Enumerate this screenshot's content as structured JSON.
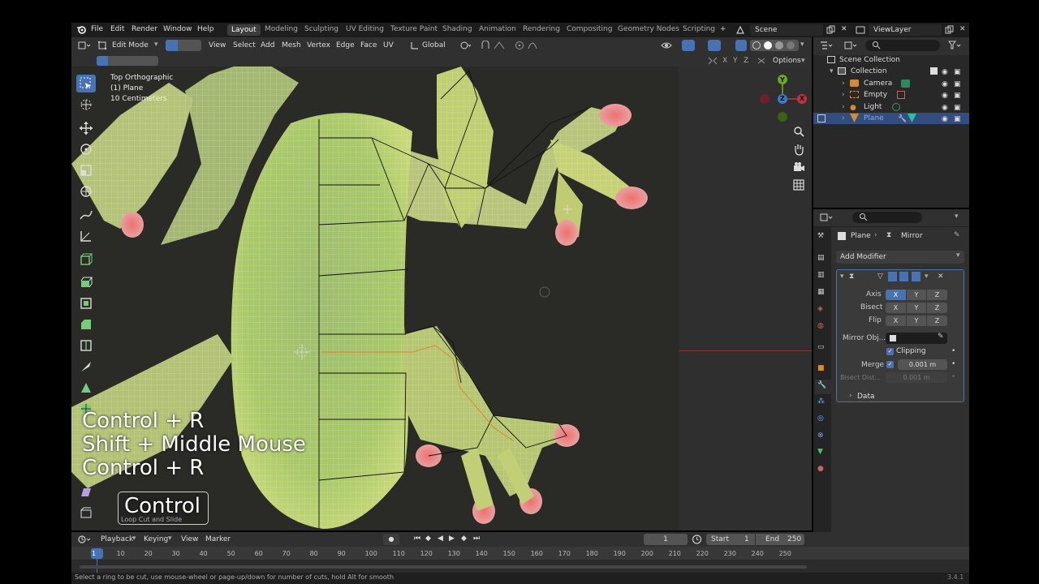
{
  "menus": [
    "File",
    "Edit",
    "Render",
    "Window",
    "Help"
  ],
  "workspaces": [
    "Layout",
    "Modeling",
    "Sculpting",
    "UV Editing",
    "Texture Paint",
    "Shading",
    "Animation",
    "Rendering",
    "Compositing",
    "Geometry Nodes",
    "Scripting"
  ],
  "scene": "Scene",
  "view_layer": "ViewLayer",
  "viewport_header": {
    "mode": "Edit Mode",
    "menus": [
      "View",
      "Select",
      "Add",
      "Mesh",
      "Vertex",
      "Edge",
      "Face",
      "UV"
    ],
    "orientation": "Global",
    "axes": [
      "X",
      "Y",
      "Z"
    ],
    "options": "Options"
  },
  "viewport_info": {
    "view": "Top Orthographic",
    "object": "(1) Plane",
    "scale": "10 Centimeters"
  },
  "gizmo_axes": {
    "y": "Y",
    "z": "Z",
    "x": "X"
  },
  "keystrokes": [
    "Control + R",
    "Shift + Middle Mouse",
    "Control + R"
  ],
  "modifier_key": {
    "label": "Control",
    "hint": "Loop Cut and Slide"
  },
  "outliner": {
    "root": "Scene Collection",
    "collection": "Collection",
    "items": [
      "Camera",
      "Empty",
      "Light",
      "Plane"
    ]
  },
  "properties": {
    "breadcrumb_object": "Plane",
    "breadcrumb_modifier": "Mirror",
    "add_modifier": "Add Modifier",
    "axis_label": "Axis",
    "bisect_label": "Bisect",
    "flip_label": "Flip",
    "xyz": [
      "X",
      "Y",
      "Z"
    ],
    "mirror_object_label": "Mirror Obj...",
    "clipping_label": "Clipping",
    "merge_label": "Merge",
    "merge_value": "0.001 m",
    "bisect_dist_label": "Bisect Dist...",
    "bisect_dist_value": "0.001 m",
    "data_label": "Data"
  },
  "timeline": {
    "menus": [
      "Playback",
      "Keying",
      "View",
      "Marker"
    ],
    "current_frame": "1",
    "start_label": "Start",
    "start_value": "1",
    "end_label": "End",
    "end_value": "250",
    "ticks": [
      "1",
      "10",
      "20",
      "30",
      "40",
      "50",
      "60",
      "70",
      "80",
      "90",
      "100",
      "110",
      "120",
      "130",
      "140",
      "150",
      "160",
      "170",
      "180",
      "190",
      "200",
      "210",
      "220",
      "230",
      "240",
      "250"
    ]
  },
  "status_bar": {
    "message": "Select a ring to be cut, use mouse-wheel or page-up/down for number of cuts, hold Alt for smooth",
    "version": "3.4.1"
  },
  "colors": {
    "accent": "#4772b3",
    "selected_row": "#334d80",
    "active_ws": "#3d3d3d"
  }
}
